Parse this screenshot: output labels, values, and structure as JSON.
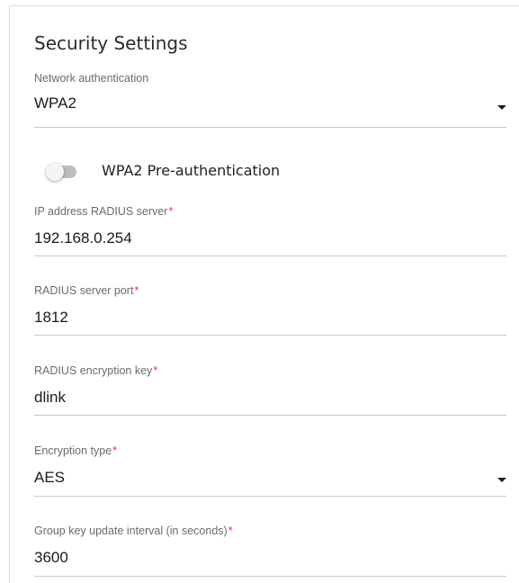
{
  "security": {
    "title": "Security Settings",
    "network_auth": {
      "label": "Network authentication",
      "value": "WPA2"
    },
    "preauth": {
      "label": "WPA2 Pre-authentication",
      "enabled": false
    },
    "radius_ip": {
      "label": "IP address RADIUS server",
      "required_mark": "*",
      "value": "192.168.0.254"
    },
    "radius_port": {
      "label": "RADIUS server port",
      "required_mark": "*",
      "value": "1812"
    },
    "radius_key": {
      "label": "RADIUS encryption key",
      "required_mark": "*",
      "value": "dlink"
    },
    "encryption_type": {
      "label": "Encryption type",
      "required_mark": "*",
      "value": "AES"
    },
    "group_key_interval": {
      "label": "Group key update interval (in seconds)",
      "required_mark": "*",
      "value": "3600"
    }
  },
  "colors": {
    "required": "#e53935",
    "toggle_off_track": "#bdbdbd",
    "divider": "#c9c9c9"
  },
  "icons": {
    "dropdown": "caret-down-icon"
  }
}
